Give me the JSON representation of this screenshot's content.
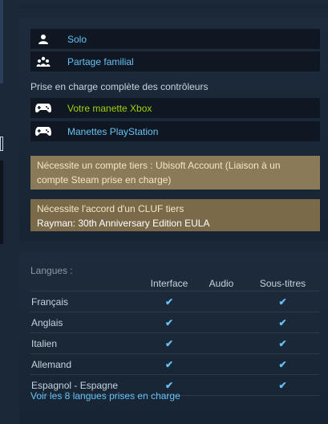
{
  "features": [
    {
      "icon": "person-icon",
      "label": "Solo"
    },
    {
      "icon": "family-icon",
      "label": "Partage familial"
    }
  ],
  "controllers": {
    "title": "Prise en charge complète des contrôleurs",
    "items": [
      {
        "icon": "gamepad-icon",
        "label": "Votre manette Xbox",
        "color": "#a3cf06"
      },
      {
        "icon": "gamepad-icon",
        "label": "Manettes PlayStation",
        "color": "#67c1f5"
      }
    ]
  },
  "notices": {
    "account": "Nécessite un compte tiers : Ubisoft Account (Liaison à un compte Steam prise en charge)",
    "eula_title": "Nécessite l'accord d'un CLUF tiers",
    "eula_name": "Rayman: 30th Anniversary Edition EULA"
  },
  "languages": {
    "title": "Langues :",
    "headers": [
      "Interface",
      "Audio",
      "Sous-titres"
    ],
    "rows": [
      {
        "name": "Français",
        "interface": "✔",
        "audio": "",
        "subtitles": "✔"
      },
      {
        "name": "Anglais",
        "interface": "✔",
        "audio": "",
        "subtitles": "✔"
      },
      {
        "name": "Italien",
        "interface": "✔",
        "audio": "",
        "subtitles": "✔"
      },
      {
        "name": "Allemand",
        "interface": "✔",
        "audio": "",
        "subtitles": "✔"
      },
      {
        "name": "Espagnol - Espagne",
        "interface": "✔",
        "audio": "",
        "subtitles": "✔"
      }
    ],
    "more_link": "Voir les 8 langues prises en charge"
  }
}
